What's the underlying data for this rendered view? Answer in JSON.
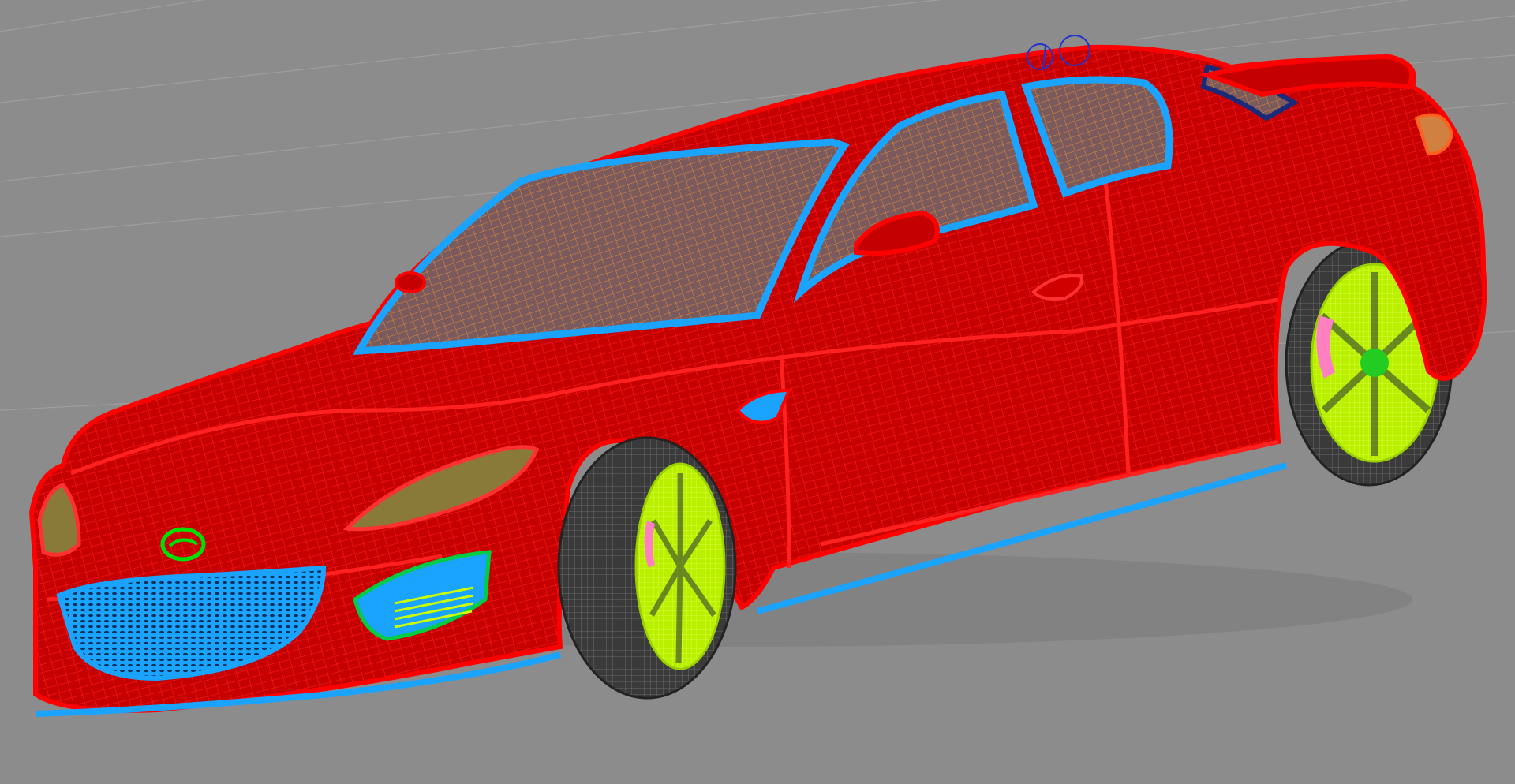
{
  "viewport": {
    "view": "perspective",
    "display_mode": "wireframe",
    "background_color": "#8c8c8c",
    "grid_color": "#9e9e9e",
    "grid": true
  },
  "model": {
    "body_wire_color": "#ff0000",
    "body_fill_color": "#c00000",
    "glass_frame_color": "#1aa3ff",
    "glass_wire_color": "#e08a3a",
    "rim_color": "#ccff00",
    "tire_color": "#333333",
    "logo_color": "#00e000",
    "caliper_color": "#ff80c0",
    "pivot_color": "#2233cc"
  },
  "icons": {
    "selection_pivot": "circle-gizmo-icon"
  }
}
